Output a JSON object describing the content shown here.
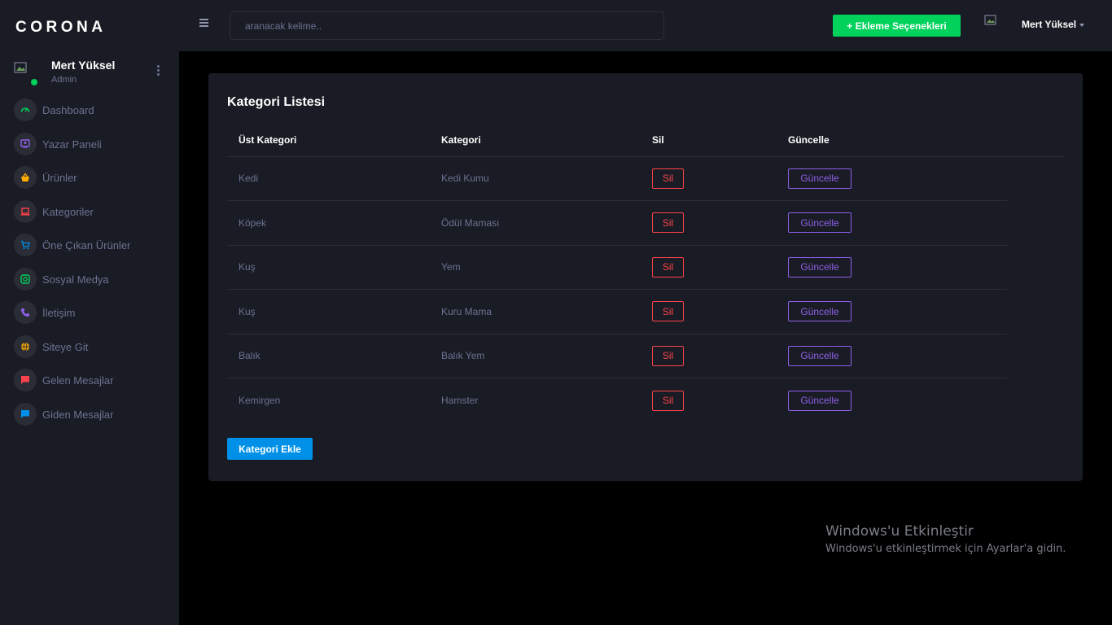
{
  "brand": "CORONA",
  "profile": {
    "name": "Mert Yüksel",
    "role": "Admin"
  },
  "sidebar": {
    "items": [
      {
        "label": "Dashboard",
        "icon": "speedometer-icon",
        "color": "#00d25b"
      },
      {
        "label": "Yazar Paneli",
        "icon": "author-icon",
        "color": "#8f5fe8"
      },
      {
        "label": "Ürünler",
        "icon": "basket-icon",
        "color": "#ffab00"
      },
      {
        "label": "Kategoriler",
        "icon": "laptop-icon",
        "color": "#fc424a"
      },
      {
        "label": "Öne Çıkan Ürünler",
        "icon": "cart-icon",
        "color": "#0090e7"
      },
      {
        "label": "Sosyal Medya",
        "icon": "instagram-icon",
        "color": "#00d25b"
      },
      {
        "label": "İletişim",
        "icon": "phone-icon",
        "color": "#8f5fe8"
      },
      {
        "label": "Siteye Git",
        "icon": "globe-icon",
        "color": "#ffab00"
      },
      {
        "label": "Gelen Mesajlar",
        "icon": "message-in-icon",
        "color": "#fc424a"
      },
      {
        "label": "Giden Mesajlar",
        "icon": "message-out-icon",
        "color": "#0090e7"
      }
    ]
  },
  "navbar": {
    "search_placeholder": "aranacak kelime..",
    "add_button": "+ Ekleme Seçenekleri",
    "user": "Mert Yüksel"
  },
  "card": {
    "title": "Kategori Listesi",
    "headers": [
      "Üst Kategori",
      "Kategori",
      "Sil",
      "Güncelle"
    ],
    "rows": [
      {
        "parent": "Kedi",
        "category": "Kedi Kumu",
        "delete": "Sil",
        "update": "Güncelle"
      },
      {
        "parent": "Köpek",
        "category": "Ödül Maması",
        "delete": "Sil",
        "update": "Güncelle"
      },
      {
        "parent": "Kuş",
        "category": "Yem",
        "delete": "Sil",
        "update": "Güncelle"
      },
      {
        "parent": "Kuş",
        "category": "Kuru Mama",
        "delete": "Sil",
        "update": "Güncelle"
      },
      {
        "parent": "Balık",
        "category": "Balık Yem",
        "delete": "Sil",
        "update": "Güncelle"
      },
      {
        "parent": "Kemirgen",
        "category": "Hamster",
        "delete": "Sil",
        "update": "Güncelle"
      }
    ],
    "add_button": "Kategori Ekle"
  },
  "watermark": {
    "title": "Windows'u Etkinleştir",
    "subtitle": "Windows'u etkinleştirmek için Ayarlar'a gidin."
  },
  "colors": {
    "background": "#000000",
    "panel": "#191c24",
    "success": "#00d25b",
    "danger": "#fc424a",
    "primary": "#0090e7",
    "purple": "#8f5fe8"
  }
}
